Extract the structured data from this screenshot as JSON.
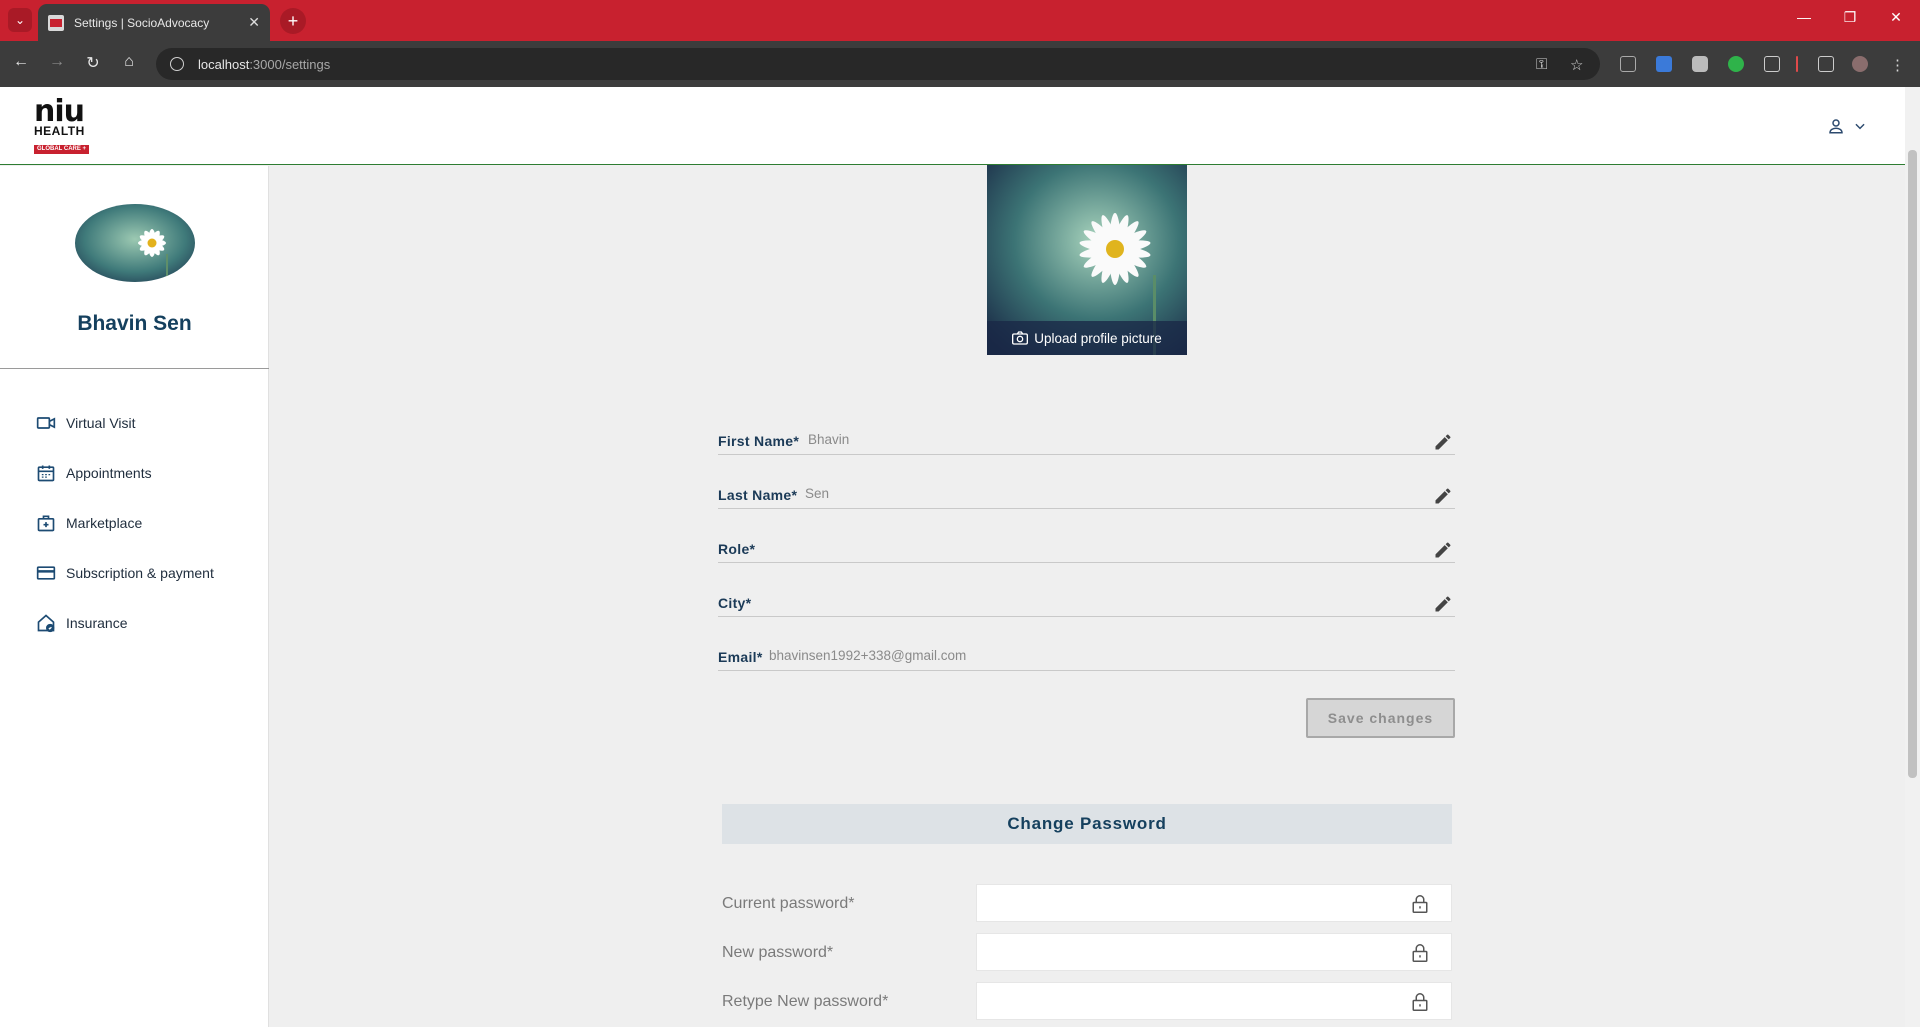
{
  "browser": {
    "tab_title": "Settings | SocioAdvocacy",
    "url_host": "localhost",
    "url_path": ":3000/settings"
  },
  "brand": {
    "logo_main": "niu",
    "logo_sub": "HEALTH",
    "logo_tag": "GLOBAL CARE +",
    "accent": "#c8212f",
    "primary": "#15405e",
    "green": "#2e7d32"
  },
  "sidebar": {
    "user_name": "Bhavin Sen",
    "items": [
      {
        "label": "Virtual Visit",
        "icon": "video-camera-icon"
      },
      {
        "label": "Appointments",
        "icon": "calendar-icon"
      },
      {
        "label": "Marketplace",
        "icon": "medical-bag-icon"
      },
      {
        "label": "Subscription & payment",
        "icon": "credit-card-icon"
      },
      {
        "label": "Insurance",
        "icon": "home-shield-icon"
      }
    ]
  },
  "profile": {
    "upload_label": "Upload profile picture",
    "fields": [
      {
        "label": "First Name*",
        "value": "Bhavin",
        "editable": true
      },
      {
        "label": "Last Name*",
        "value": "Sen",
        "editable": true
      },
      {
        "label": "Role*",
        "value": "",
        "editable": true
      },
      {
        "label": "City*",
        "value": "",
        "editable": true
      },
      {
        "label": "Email*",
        "value": "bhavinsen1992+338@gmail.com",
        "editable": false
      }
    ],
    "save_label": "Save changes"
  },
  "password": {
    "title": "Change Password",
    "fields": [
      {
        "label": "Current password*"
      },
      {
        "label": "New password*"
      },
      {
        "label": "Retype New password*"
      }
    ]
  }
}
